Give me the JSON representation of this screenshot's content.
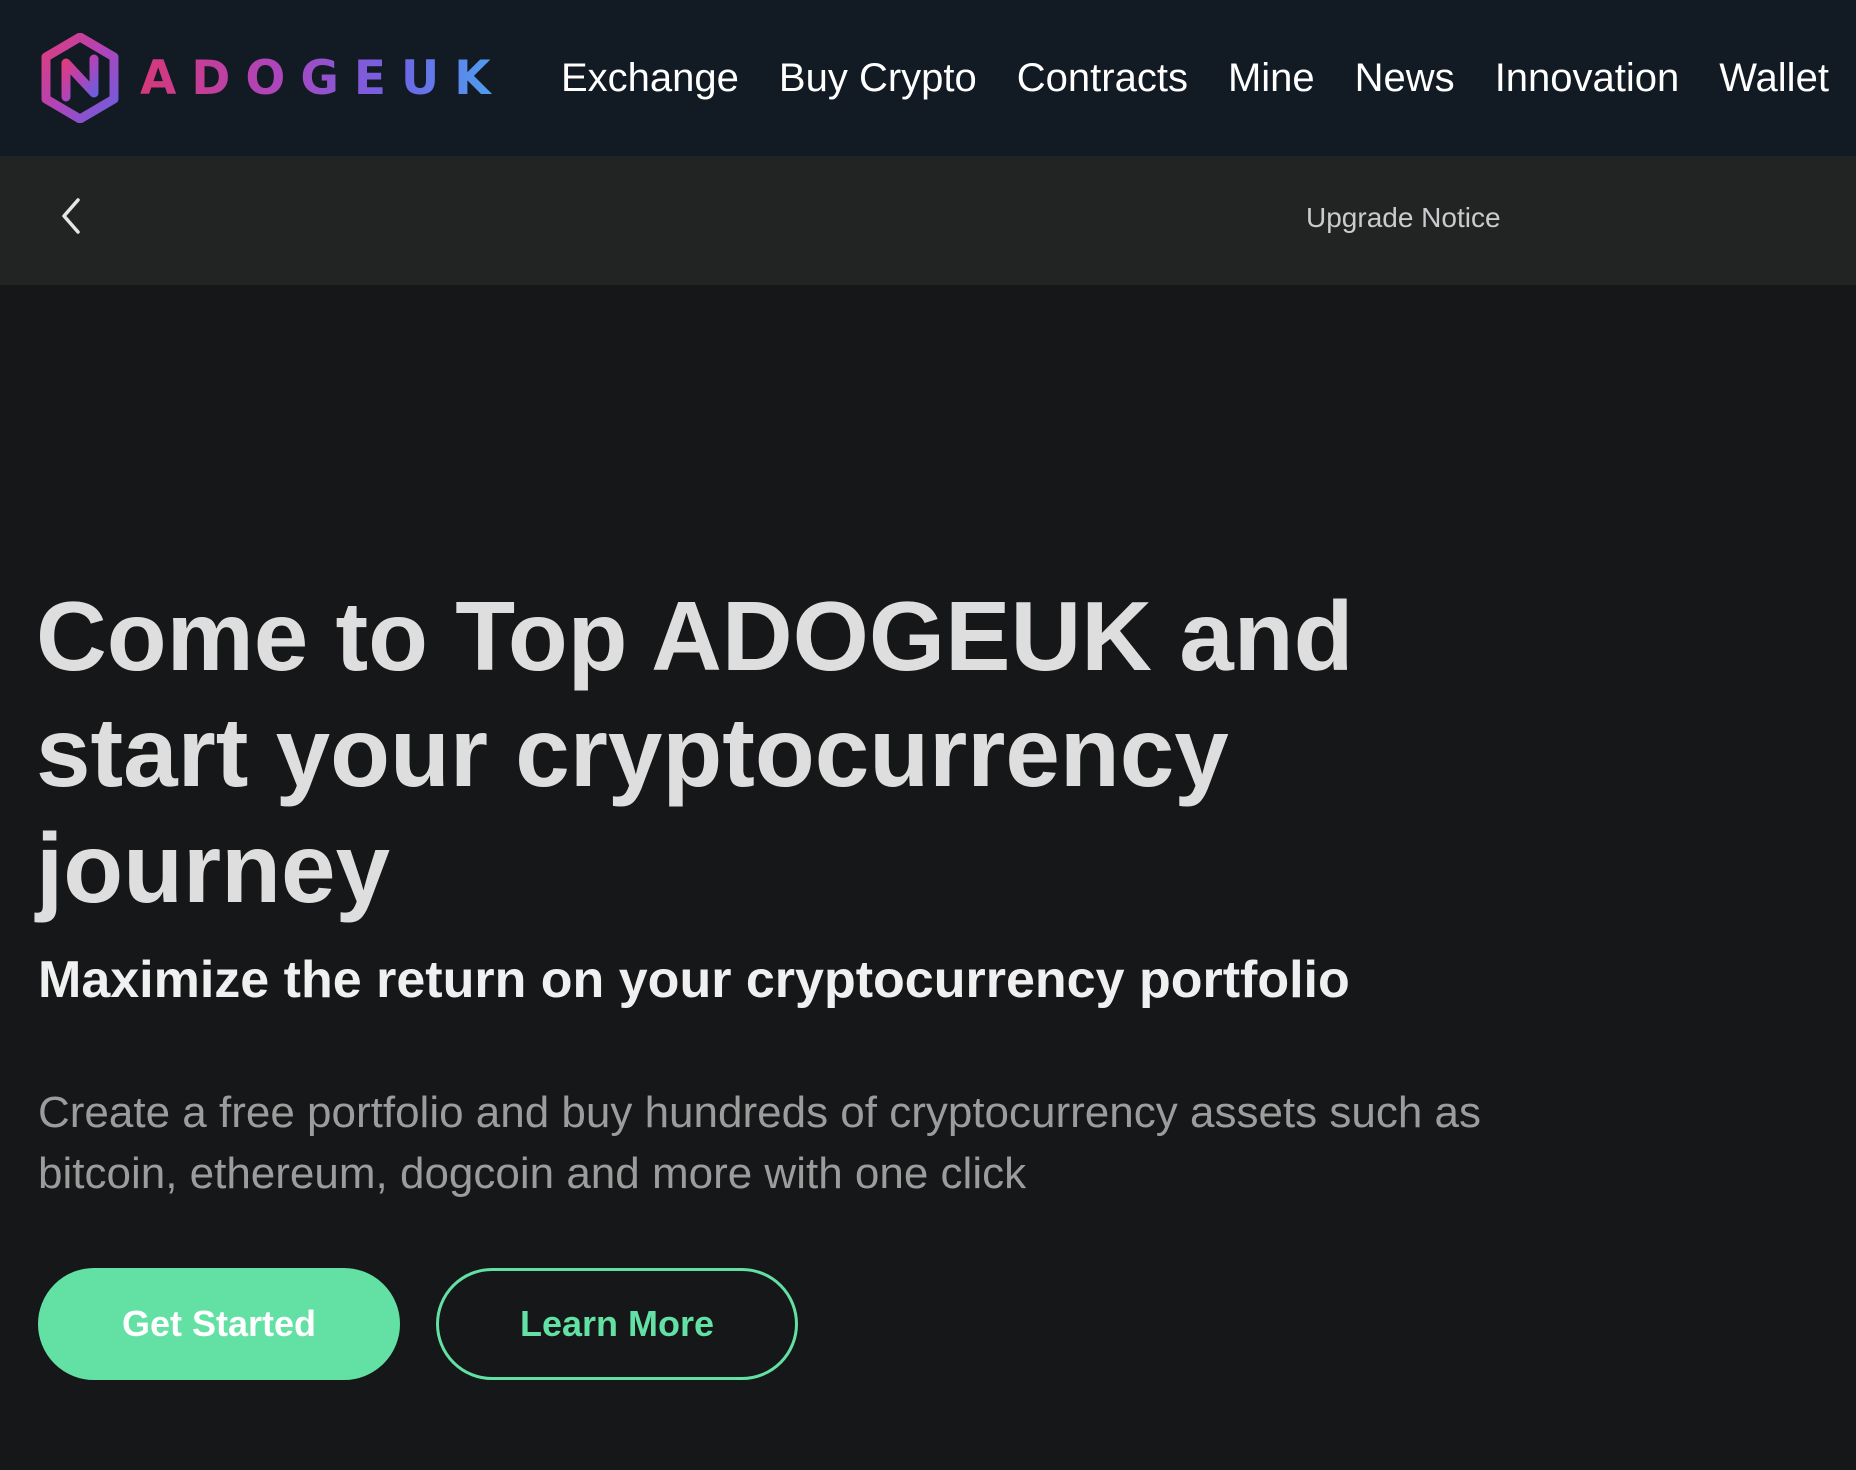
{
  "header": {
    "brand": "ADOGEUK",
    "nav": [
      {
        "label": "Exchange"
      },
      {
        "label": "Buy Crypto"
      },
      {
        "label": "Contracts"
      },
      {
        "label": "Mine"
      },
      {
        "label": "News"
      },
      {
        "label": "Innovation"
      },
      {
        "label": "Wallet"
      }
    ]
  },
  "notice": {
    "back_icon": "chevron-left-icon",
    "text": "Upgrade Notice"
  },
  "hero": {
    "title": "Come to Top ADOGEUK and start your cryptocurrency journey",
    "subtitle": "Maximize the return on your cryptocurrency portfolio",
    "description": "Create a free portfolio and buy hundreds of cryptocurrency assets such as bitcoin, ethereum, dogcoin and more with one click",
    "primary_button": "Get Started",
    "secondary_button": "Learn More"
  },
  "colors": {
    "header_bg": "#121a23",
    "notice_bg": "#222424",
    "page_bg": "#151718",
    "accent": "#63e0a4",
    "logo_gradient": [
      "#d6387a",
      "#b044b8",
      "#6f63e6",
      "#4aa6ef"
    ]
  }
}
